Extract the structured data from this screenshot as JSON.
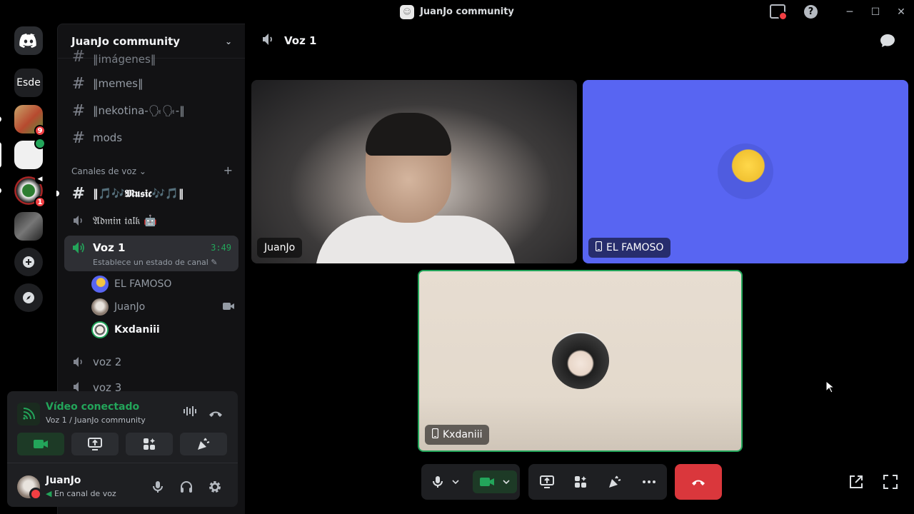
{
  "window": {
    "title": "JuanJo community",
    "controls": [
      "minimize",
      "maximize",
      "close"
    ]
  },
  "servers": {
    "esde_label": "Esde",
    "badges": {
      "server1": "9",
      "server3": "1"
    }
  },
  "sidebar": {
    "guild_name": "JuanJo community",
    "channels_text": [
      {
        "name": "‖memes‖"
      },
      {
        "name": "‖nekotina-🗣🗣-‖"
      },
      {
        "name": "mods"
      }
    ],
    "cut_channel": "‖imágenes‖",
    "category": "Canales de voz",
    "music_channel": "‖🎵🎶𝕸𝖚𝖘𝖎𝖈🎶🎵‖",
    "admin_channel": "𝔄𝔡𝔪𝔦𝔫 𝔱𝔞𝔩𝔨 🤖",
    "active_voice": {
      "name": "Voz 1",
      "time": "3:49",
      "status": "Establece un estado de canal"
    },
    "members": [
      {
        "name": "EL FAMOSO"
      },
      {
        "name": "JuanJo"
      },
      {
        "name": "Kxdaniii"
      }
    ],
    "other_voice": [
      {
        "name": "voz 2"
      },
      {
        "name": "voz 3"
      }
    ]
  },
  "rtc": {
    "title": "Vídeo conectado",
    "subtitle": "Voz 1 / JuanJo community"
  },
  "user": {
    "name": "JuanJo",
    "status": "En canal de voz"
  },
  "stage": {
    "channel_name": "Voz 1",
    "tiles": [
      {
        "name": "JuanJo"
      },
      {
        "name": "EL FAMOSO"
      },
      {
        "name": "Kxdaniii"
      }
    ]
  },
  "colors": {
    "accent": "#5865f2",
    "connected": "#23a55a",
    "danger": "#da373c"
  }
}
